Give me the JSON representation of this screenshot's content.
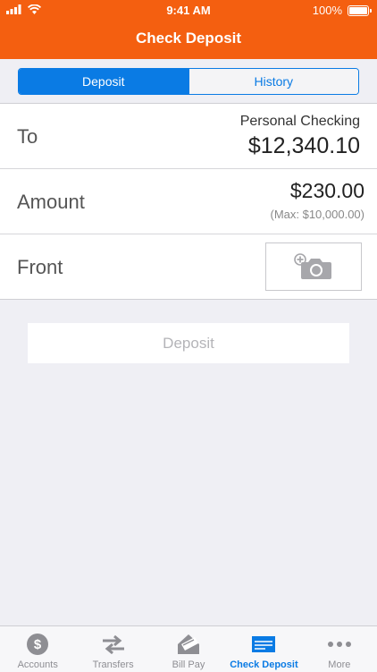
{
  "status": {
    "time": "9:41 AM",
    "battery": "100%"
  },
  "header": {
    "title": "Check Deposit"
  },
  "segments": [
    {
      "label": "Deposit",
      "active": true
    },
    {
      "label": "History",
      "active": false
    }
  ],
  "form": {
    "to_label": "To",
    "to_account": "Personal Checking",
    "to_balance": "$12,340.10",
    "amount_label": "Amount",
    "amount_value": "$230.00",
    "amount_max": "(Max: $10,000.00)",
    "front_label": "Front"
  },
  "deposit_button": "Deposit",
  "tabs": [
    {
      "label": "Accounts",
      "icon": "dollar-circle-icon"
    },
    {
      "label": "Transfers",
      "icon": "transfer-arrows-icon"
    },
    {
      "label": "Bill Pay",
      "icon": "bill-pay-icon"
    },
    {
      "label": "Check Deposit",
      "icon": "check-icon",
      "active": true
    },
    {
      "label": "More",
      "icon": "more-dots-icon"
    }
  ],
  "colors": {
    "accent": "#f45f10",
    "primary": "#0a7be4",
    "background": "#efeff4"
  }
}
